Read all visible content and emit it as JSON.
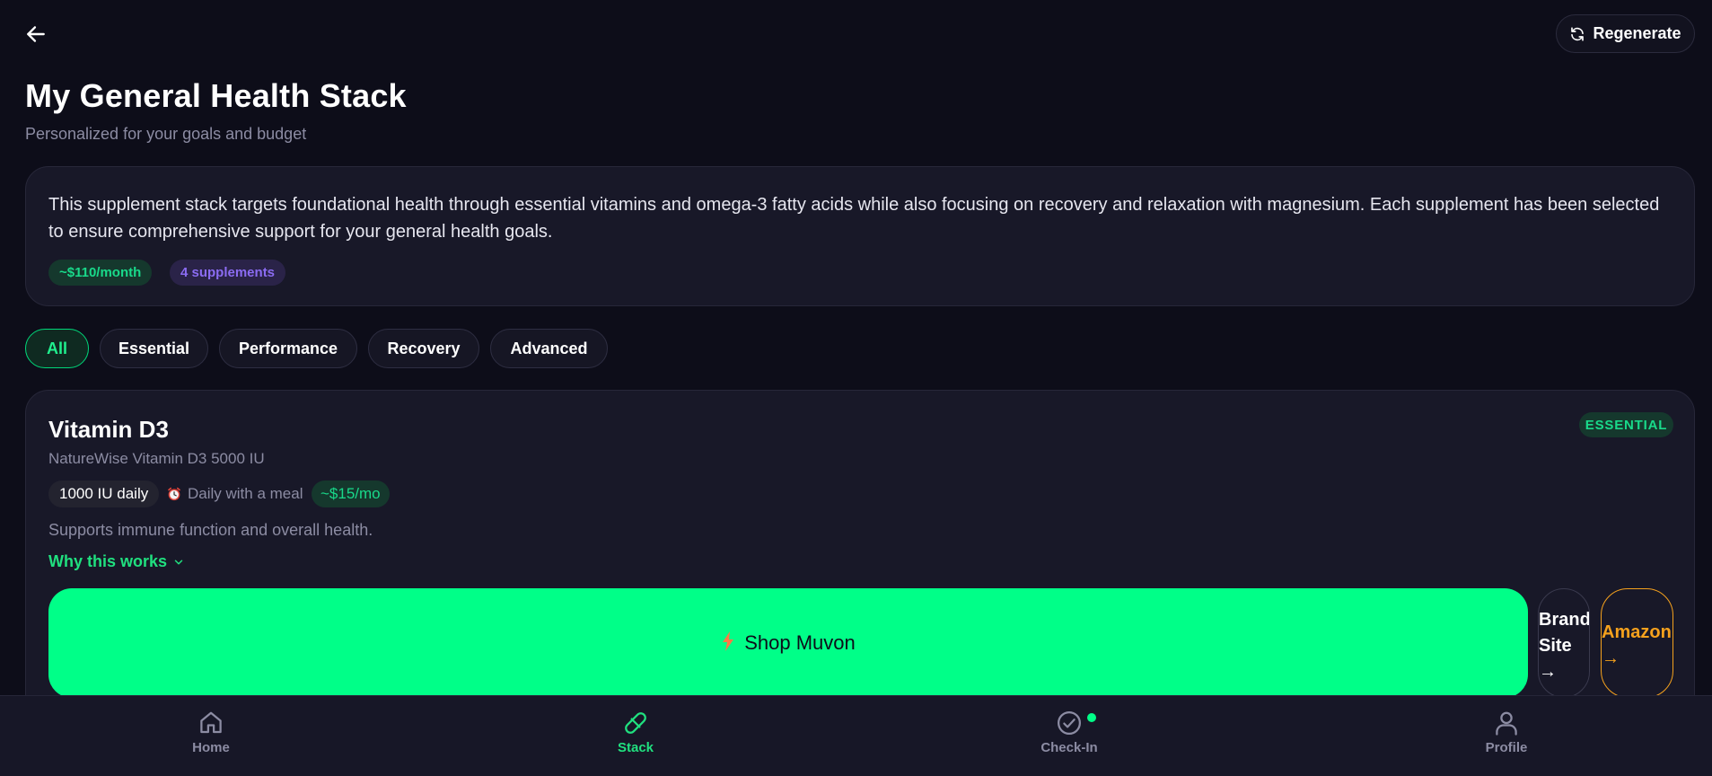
{
  "header": {
    "back_icon": "arrow-left-icon",
    "regenerate_label": "Regenerate",
    "regenerate_icon": "refresh-icon",
    "title": "My General Health Stack",
    "subtitle": "Personalized for your goals and budget"
  },
  "summary": {
    "text": "This supplement stack targets foundational health through essential vitamins and omega-3 fatty acids while also focusing on recovery and relaxation with magnesium. Each supplement has been selected to ensure comprehensive support for your general health goals.",
    "cost_badge": "~$110/month",
    "count_badge": "4 supplements"
  },
  "filters": {
    "active": "All",
    "tabs": [
      "All",
      "Essential",
      "Performance",
      "Recovery",
      "Advanced"
    ]
  },
  "supplement": {
    "name": "Vitamin D3",
    "tier_badge": "ESSENTIAL",
    "product": "NatureWise Vitamin D3 5000 IU",
    "dose": "1000 IU daily",
    "timing_icon": "alarm-clock-icon",
    "timing": "Daily with a meal",
    "price": "~$15/mo",
    "description": "Supports immune function and overall health.",
    "why_link": "Why this works",
    "shop_label": "Shop Muvon",
    "shop_icon": "lightning-icon",
    "brand_label": "Brand Site →",
    "amazon_label": "Amazon →"
  },
  "nav": {
    "active": "Stack",
    "items": [
      {
        "label": "Home",
        "icon": "home-icon"
      },
      {
        "label": "Stack",
        "icon": "pill-icon"
      },
      {
        "label": "Check-In",
        "icon": "check-circle-icon"
      },
      {
        "label": "Profile",
        "icon": "user-icon"
      }
    ]
  },
  "colors": {
    "background": "#0d0d19",
    "card": "#181828",
    "accent_green": "#00ff88",
    "accent_purple": "#8b6cf2",
    "amazon_orange": "#f5a11d"
  }
}
